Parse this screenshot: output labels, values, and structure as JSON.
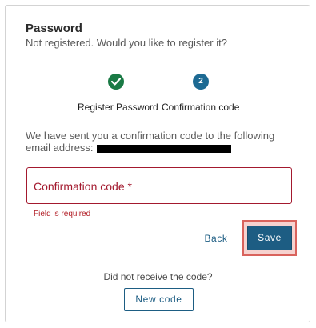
{
  "header": {
    "title": "Password",
    "subtitle": "Not registered. Would you like to register it?"
  },
  "stepper": {
    "steps": [
      {
        "label": "Register Password",
        "status": "completed",
        "icon": "check-icon"
      },
      {
        "label": "Confirmation code",
        "status": "current",
        "number": "2"
      }
    ],
    "colors": {
      "completed": "#1a7a45",
      "current": "#1d6a93"
    }
  },
  "info": {
    "text": "We have sent you a confirmation code to the following email address:"
  },
  "form": {
    "code_field": {
      "label": "Confirmation code *",
      "value": "",
      "error": "Field is required",
      "error_color": "#a3192e"
    }
  },
  "actions": {
    "back_label": "Back",
    "save_label": "Save",
    "accent": "#1d5d83"
  },
  "resend": {
    "text": "Did not receive the code?",
    "button_label": "New code"
  }
}
